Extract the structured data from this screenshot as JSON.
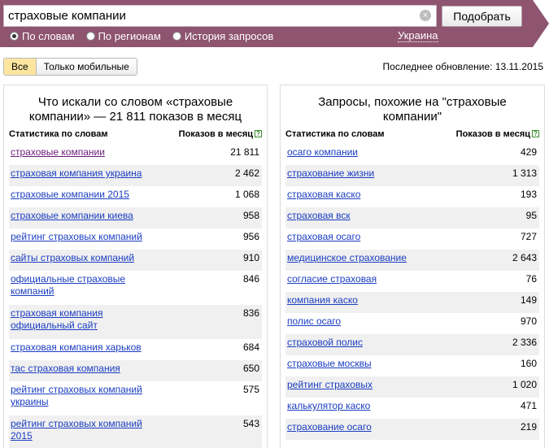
{
  "header": {
    "search_value": "страховые компании",
    "clear_symbol": "×",
    "submit_label": "Подобрать",
    "modes": [
      {
        "label": "По словам",
        "selected": true
      },
      {
        "label": "По регионам",
        "selected": false
      },
      {
        "label": "История запросов",
        "selected": false
      }
    ],
    "region": "Украина",
    "brand_color": "#8e5470"
  },
  "toolbar": {
    "filter_all": "Все",
    "filter_mobile": "Только мобильные",
    "last_update": "Последнее обновление: 13.11.2015"
  },
  "left_panel": {
    "title": "Что искали со словом «страховые компании» — 21 811 показов в месяц",
    "col_keyword": "Статистика по словам",
    "col_count": "Показов в месяц",
    "help_icon": "?",
    "rows": [
      {
        "keyword": "страховые компании",
        "count": "21 811"
      },
      {
        "keyword": "страховая компания украина",
        "count": "2 462"
      },
      {
        "keyword": "страховые компании 2015",
        "count": "1 068"
      },
      {
        "keyword": "страховые компании киева",
        "count": "958"
      },
      {
        "keyword": "рейтинг страховых компаний",
        "count": "956"
      },
      {
        "keyword": "сайты страховых компаний",
        "count": "910"
      },
      {
        "keyword": "официальные страховые компаний",
        "count": "846"
      },
      {
        "keyword": "страховая компания официальный сайт",
        "count": "836"
      },
      {
        "keyword": "страховая компания харьков",
        "count": "684"
      },
      {
        "keyword": "тас страховая компания",
        "count": "650"
      },
      {
        "keyword": "рейтинг страховых компаний украины",
        "count": "575"
      },
      {
        "keyword": "рейтинг страховых компаний 2015",
        "count": "543"
      }
    ]
  },
  "right_panel": {
    "title": "Запросы, похожие на \"страховые компании\"",
    "col_keyword": "Статистика по словам",
    "col_count": "Показов в месяц",
    "help_icon": "?",
    "rows": [
      {
        "keyword": "осаго компании",
        "count": "429"
      },
      {
        "keyword": "страхование жизни",
        "count": "1 313"
      },
      {
        "keyword": "страховая каско",
        "count": "193"
      },
      {
        "keyword": "страховая вск",
        "count": "95"
      },
      {
        "keyword": "страховая осаго",
        "count": "727"
      },
      {
        "keyword": "медицинское страхование",
        "count": "2 643"
      },
      {
        "keyword": "согласие страховая",
        "count": "76"
      },
      {
        "keyword": "компания каско",
        "count": "149"
      },
      {
        "keyword": "полис осаго",
        "count": "970"
      },
      {
        "keyword": "страховой полис",
        "count": "2 336"
      },
      {
        "keyword": "страховые москвы",
        "count": "160"
      },
      {
        "keyword": "рейтинг страховых",
        "count": "1 020"
      },
      {
        "keyword": "калькулятор каско",
        "count": "471"
      },
      {
        "keyword": "страхование осаго",
        "count": "219"
      }
    ]
  }
}
